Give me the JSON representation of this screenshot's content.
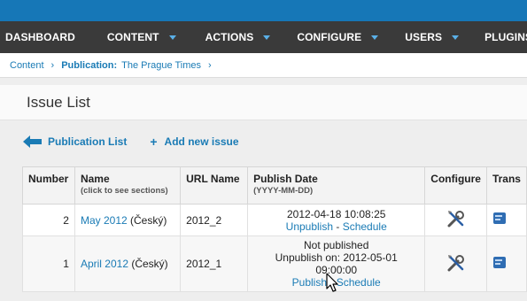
{
  "nav": [
    {
      "label": "DASHBOARD",
      "has_menu": false
    },
    {
      "label": "CONTENT",
      "has_menu": true
    },
    {
      "label": "ACTIONS",
      "has_menu": true
    },
    {
      "label": "CONFIGURE",
      "has_menu": true
    },
    {
      "label": "USERS",
      "has_menu": true
    },
    {
      "label": "PLUGINS",
      "has_menu": true
    }
  ],
  "breadcrumb": {
    "root": "Content",
    "publication_label": "Publication:",
    "publication_name": "The Prague Times"
  },
  "page_title": "Issue List",
  "actions": {
    "back": "Publication List",
    "add": "Add new issue"
  },
  "table": {
    "headers": {
      "number": "Number",
      "name": "Name",
      "name_sub": "(click to see sections)",
      "url": "URL Name",
      "date": "Publish Date",
      "date_sub": "(YYYY-MM-DD)",
      "configure": "Configure",
      "translate": "Trans"
    },
    "rows": [
      {
        "number": "2",
        "name_link": "May 2012",
        "language": " (Český)",
        "url": "2012_2",
        "date_line1": "2012-04-18 10:08:25",
        "action1": "Unpublish",
        "sep": " - ",
        "action2": "Schedule"
      },
      {
        "number": "1",
        "name_link": "April 2012",
        "language": " (Český)",
        "url": "2012_1",
        "date_line1": "Not published",
        "date_line2": "Unpublish on: 2012-05-01 09:00:00",
        "action1": "Publish",
        "sep": " - ",
        "action2": "Schedule"
      }
    ]
  },
  "colors": {
    "topbar": "#1677b7",
    "navbar": "#3a3a3a",
    "link": "#1a7bb5",
    "caret": "#5ab0e8"
  },
  "icons": {
    "back": "arrow-left-icon",
    "add": "plus-icon",
    "configure": "wrench-screwdriver-icon",
    "translate": "translate-icon",
    "cursor": "mouse-pointer-icon"
  }
}
